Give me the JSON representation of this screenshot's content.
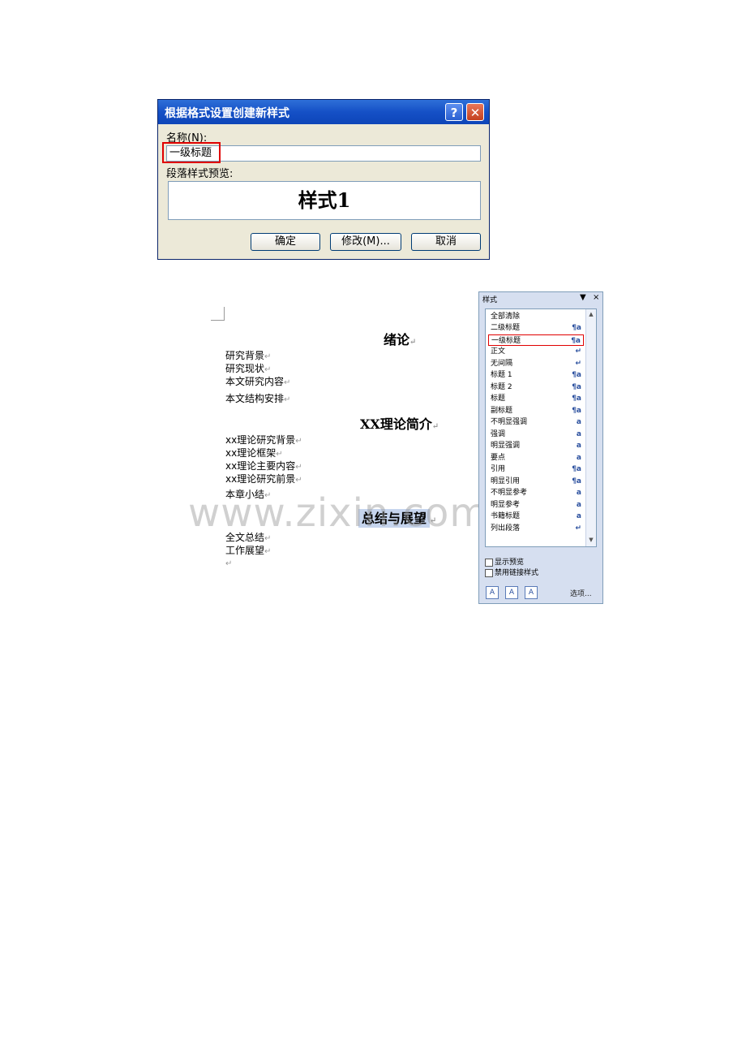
{
  "dialog": {
    "title": "根据格式设置创建新样式",
    "help_glyph": "?",
    "close_glyph": "✕",
    "name_label": "名称(N):",
    "name_value": "一级标题",
    "preview_label": "段落样式预览:",
    "preview_text": "样式1",
    "ok_label": "确定",
    "modify_label": "修改(M)...",
    "cancel_label": "取消"
  },
  "document": {
    "paragraph_mark": "↵",
    "sections": [
      {
        "heading": "绪论",
        "items": [
          "研究背景",
          "研究现状",
          "本文研究内容",
          "本文结构安排"
        ]
      },
      {
        "heading": "XX理论简介",
        "items": [
          "xx理论研究背景",
          "xx理论框架",
          "xx理论主要内容",
          "xx理论研究前景",
          "本章小结"
        ]
      },
      {
        "heading": "总结与展望",
        "items": [
          "全文总结",
          "工作展望"
        ]
      }
    ]
  },
  "styles_panel": {
    "title": "样式",
    "dropdown_glyph": "▼",
    "close_glyph": "×",
    "items": [
      {
        "name": "全部清除",
        "icon": ""
      },
      {
        "name": "二级标题",
        "icon": "¶a"
      },
      {
        "name": "一级标题",
        "icon": "¶a"
      },
      {
        "name": "正文",
        "icon": "↵"
      },
      {
        "name": "无间隔",
        "icon": "↵"
      },
      {
        "name": "标题 1",
        "icon": "¶a"
      },
      {
        "name": "标题 2",
        "icon": "¶a"
      },
      {
        "name": "标题",
        "icon": "¶a"
      },
      {
        "name": "副标题",
        "icon": "¶a"
      },
      {
        "name": "不明显强调",
        "icon": "a"
      },
      {
        "name": "强调",
        "icon": "a"
      },
      {
        "name": "明显强调",
        "icon": "a"
      },
      {
        "name": "要点",
        "icon": "a"
      },
      {
        "name": "引用",
        "icon": "¶a"
      },
      {
        "name": "明显引用",
        "icon": "¶a"
      },
      {
        "name": "不明显参考",
        "icon": "a"
      },
      {
        "name": "明显参考",
        "icon": "a"
      },
      {
        "name": "书籍标题",
        "icon": "a"
      },
      {
        "name": "列出段落",
        "icon": "↵"
      }
    ],
    "show_preview_label": "显示预览",
    "disable_linked_label": "禁用链接样式",
    "options_label": "选项..."
  },
  "watermark": "www.zixin.com.cn"
}
